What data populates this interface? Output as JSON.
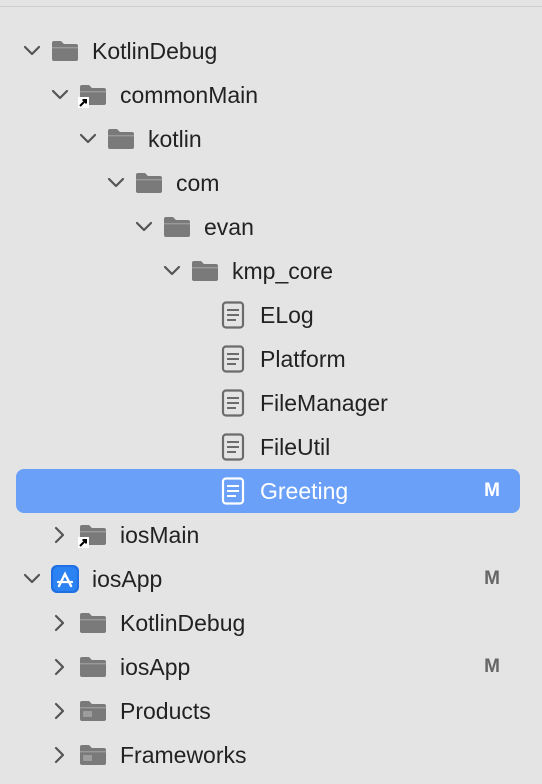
{
  "navigator": {
    "rows": [
      {
        "label": "KotlinDebug",
        "badge": ""
      },
      {
        "label": "commonMain",
        "badge": ""
      },
      {
        "label": "kotlin",
        "badge": ""
      },
      {
        "label": "com",
        "badge": ""
      },
      {
        "label": "evan",
        "badge": ""
      },
      {
        "label": "kmp_core",
        "badge": ""
      },
      {
        "label": "ELog",
        "badge": ""
      },
      {
        "label": "Platform",
        "badge": ""
      },
      {
        "label": "FileManager",
        "badge": ""
      },
      {
        "label": "FileUtil",
        "badge": ""
      },
      {
        "label": "Greeting",
        "badge": "M"
      },
      {
        "label": "iosMain",
        "badge": ""
      },
      {
        "label": "iosApp",
        "badge": "M"
      },
      {
        "label": "KotlinDebug",
        "badge": ""
      },
      {
        "label": "iosApp",
        "badge": "M"
      },
      {
        "label": "Products",
        "badge": ""
      },
      {
        "label": "Frameworks",
        "badge": ""
      }
    ],
    "selected_item": "Greeting"
  },
  "icons": {
    "folder": "folder-icon",
    "folder_alias": "folder-alias-icon",
    "file": "swift-file-icon",
    "project": "xcode-project-icon",
    "expanded": "chevron-down-icon",
    "collapsed": "chevron-right-icon"
  },
  "colors": {
    "background": "#e4e4e4",
    "selection": "#6aa0f7",
    "folder": "#7a7a7a",
    "project_icon": "#1f6fe5",
    "badge": "#666666"
  }
}
